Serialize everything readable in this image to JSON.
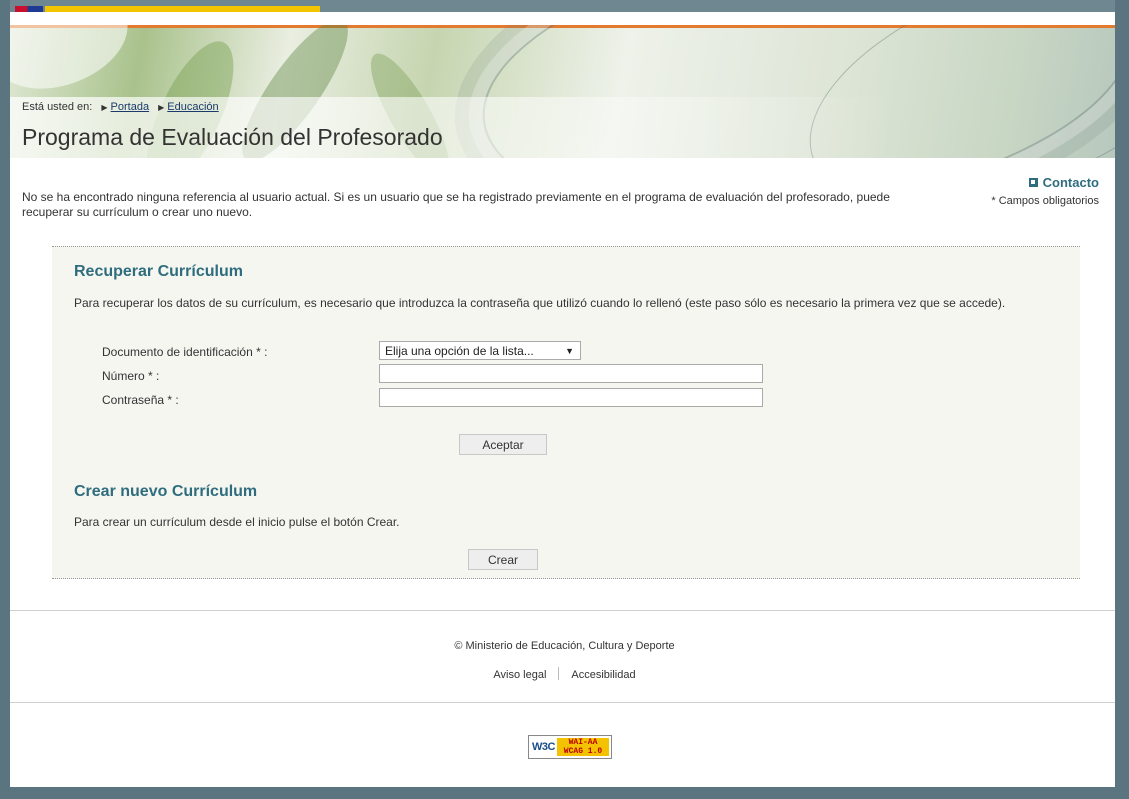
{
  "breadcrumb": {
    "prefix": "Está usted en:",
    "items": [
      "Portada",
      "Educación"
    ]
  },
  "page_title": "Programa de Evaluación del Profesorado",
  "intro_text": "No se ha encontrado ninguna referencia al usuario actual. Si es un usuario que se ha registrado previamente en el programa de evaluación del profesorado, puede recuperar su currículum o crear uno nuevo.",
  "contact_label": "Contacto",
  "required_note": "* Campos obligatorios",
  "recover": {
    "title": "Recuperar Currículum",
    "description": "Para recuperar los datos de su currículum, es necesario que introduzca la contraseña que utilizó cuando lo rellenó (este paso sólo es necesario la primera vez que se accede).",
    "fields": {
      "doc_label": "Documento de identificación * :",
      "doc_select_value": "Elija una opción de la lista...",
      "number_label": "Número * :",
      "number_value": "",
      "password_label": "Contraseña * :",
      "password_value": ""
    },
    "submit_label": "Aceptar"
  },
  "create": {
    "title": "Crear nuevo Currículum",
    "description": "Para crear un currículum desde el inicio pulse el botón Crear.",
    "button_label": "Crear"
  },
  "footer": {
    "copyright": "© Ministerio de Educación, Cultura y Deporte",
    "links": [
      "Aviso legal",
      "Accesibilidad"
    ]
  },
  "badge": {
    "w3c": "W3C",
    "wai_line1": "WAI-AA",
    "wai_line2": "WCAG 1.0"
  },
  "colors": {
    "accent": "#2f6d7e",
    "frame": "#5a7580",
    "panel_bg": "#f6f6f1"
  }
}
